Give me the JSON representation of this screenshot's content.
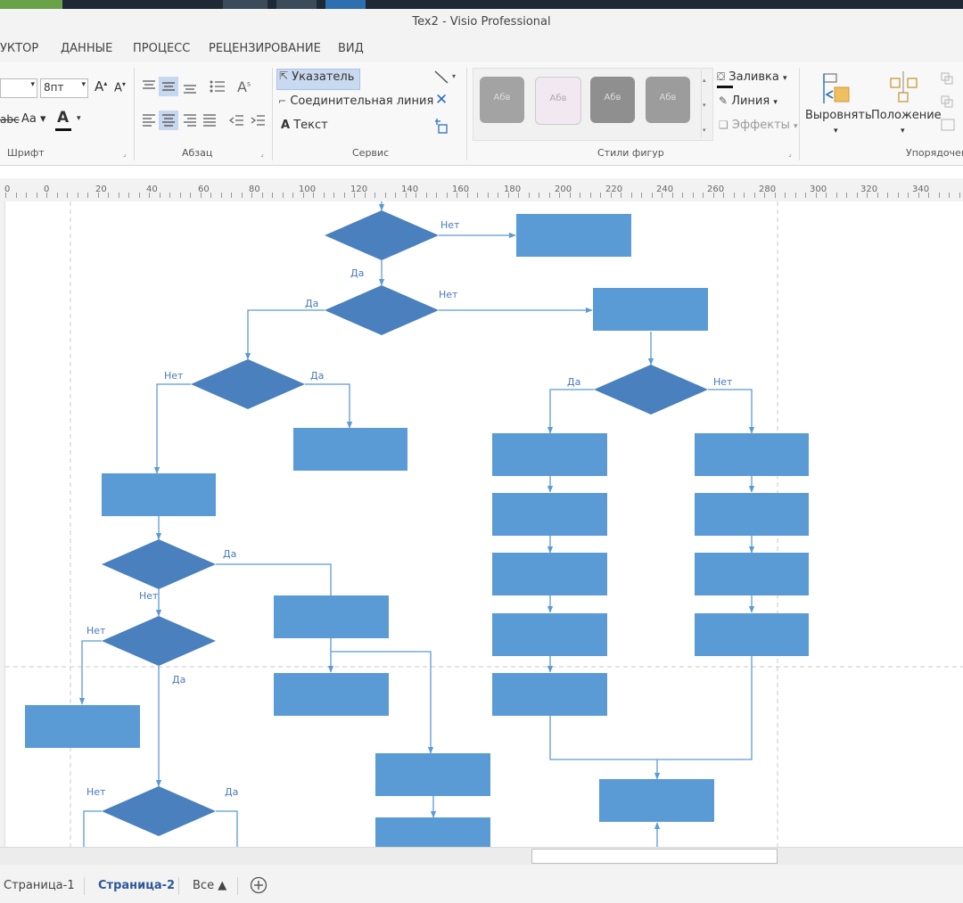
{
  "window": {
    "title": "Tex2 - Visio Professional"
  },
  "menu": [
    "УКТОР",
    "ДАННЫЕ",
    "ПРОЦЕСС",
    "РЕЦЕНЗИРОВАНИЕ",
    "ВИД"
  ],
  "ribbon": {
    "font": {
      "size_value": "8пт",
      "group_label": "Шрифт",
      "case_label": "Аа",
      "strike_label": "abc"
    },
    "paragraph": {
      "group_label": "Абзац"
    },
    "tools": {
      "pointer_label": "Указатель",
      "connector_label": "Соединительная линия",
      "text_label": "Текст",
      "group_label": "Сервис"
    },
    "shape_styles": {
      "group_label": "Стили фигур",
      "tiles": [
        "Абв",
        "Абв",
        "Абв",
        "Абв"
      ],
      "fill_label": "Заливка",
      "line_label": "Линия",
      "effects_label": "Эффекты"
    },
    "arrange": {
      "align_label": "Выровнять",
      "position_label": "Положение",
      "group_label": "Упорядочен"
    }
  },
  "ruler": {
    "labels": [
      "0",
      "0",
      "20",
      "40",
      "60",
      "80",
      "100",
      "120",
      "140",
      "160",
      "180",
      "200",
      "220",
      "240",
      "260",
      "280",
      "300",
      "320",
      "340"
    ]
  },
  "flowchart": {
    "labels": [
      "Нет",
      "Да",
      "Да",
      "Нет",
      "Нет",
      "Да",
      "Да",
      "Нет",
      "Да",
      "Нет",
      "Нет",
      "Да",
      "Нет",
      "Да"
    ]
  },
  "tabs": {
    "page1": "Страница-1",
    "page2": "Страница-2",
    "all": "Все ▲"
  },
  "colors": {
    "shape_fill": "#5b9bd5",
    "diamond_fill": "#4a80bd",
    "line": "#5b9bd5",
    "label": "#4a7ab8"
  }
}
